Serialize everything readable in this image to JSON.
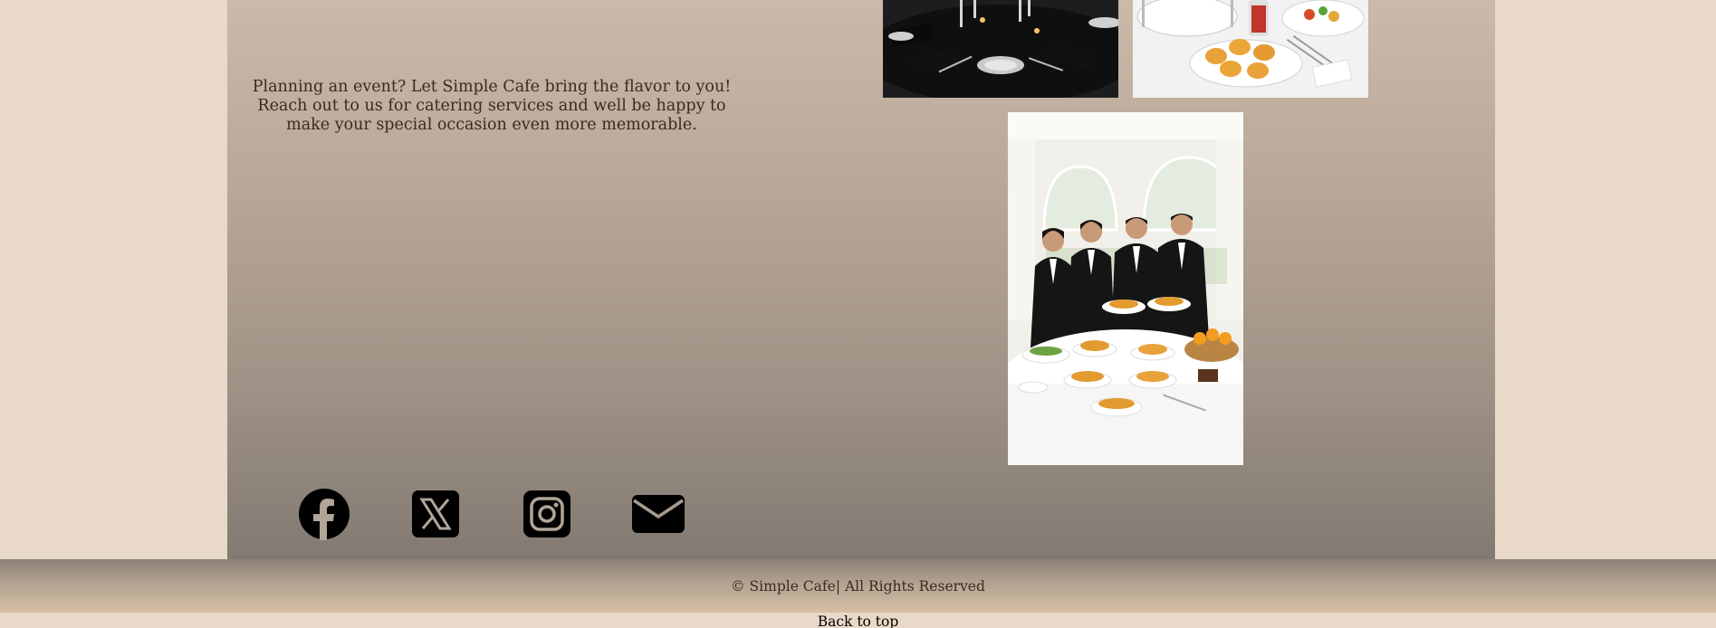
{
  "main": {
    "intro_text": "Planning an event? Let Simple Cafe bring the flavor to you! Reach out to us for catering services and well be happy to make your special occasion even more memorable."
  },
  "gallery": {
    "images": [
      {
        "name": "dinner-table-photo"
      },
      {
        "name": "plated-food-photo"
      },
      {
        "name": "catering-staff-photo"
      }
    ]
  },
  "social": {
    "icons": [
      "facebook-icon",
      "x-icon",
      "instagram-icon",
      "email-icon"
    ],
    "icon_color": "#000000"
  },
  "footer": {
    "copyright": "© Simple Cafe| All Rights Reserved",
    "back_to_top": "Back to top"
  },
  "colors": {
    "page_background": "#e9d9c8",
    "panel_top": "#cbb9aa",
    "panel_bottom": "#827a72",
    "text": "#3a2a22"
  }
}
